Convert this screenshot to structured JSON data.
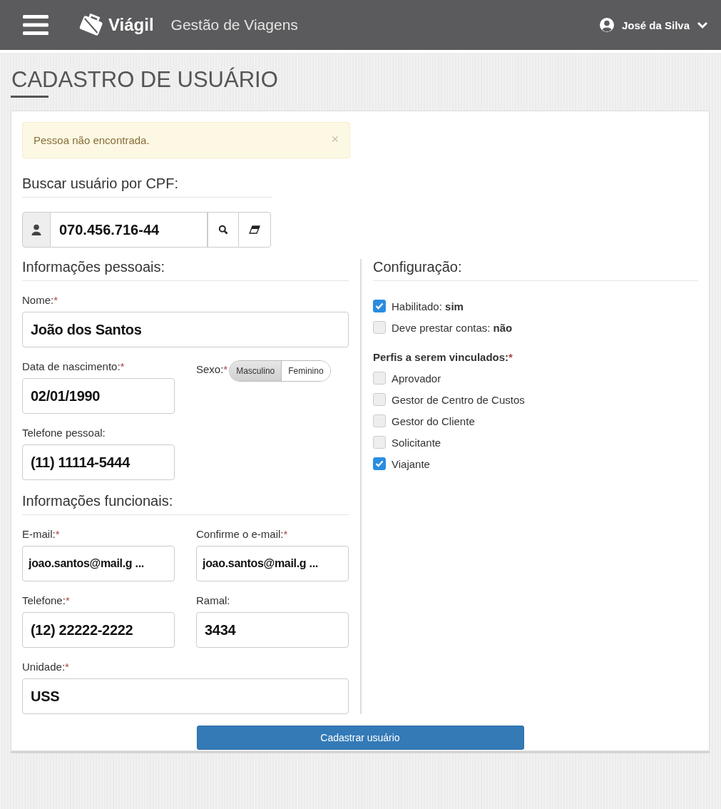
{
  "header": {
    "brand": "Viágil",
    "subtitle": "Gestão de Viagens",
    "user": "José da Silva"
  },
  "page_title": "CADASTRO DE USUÁRIO",
  "alert": {
    "message": "Pessoa não encontrada.",
    "close": "×"
  },
  "search": {
    "heading": "Buscar usuário por CPF:",
    "value": "070.456.716-44"
  },
  "personal": {
    "heading": "Informações pessoais:",
    "nome": {
      "label": "Nome:",
      "required_mark": "*",
      "value": "João dos Santos"
    },
    "nascimento": {
      "label": "Data de nascimento:",
      "required_mark": "*",
      "value": "02/01/1990"
    },
    "sexo": {
      "label": "Sexo:",
      "required_mark": "*",
      "options": [
        {
          "label": "Masculino",
          "selected": true
        },
        {
          "label": "Feminino",
          "selected": false
        }
      ]
    },
    "telefone": {
      "label": "Telefone pessoal:",
      "value": "(11) 11114-5444"
    }
  },
  "functional": {
    "heading": "Informações funcionais:",
    "fields": [
      {
        "label": "E-mail:",
        "required_mark": "*",
        "value": "joao.santos@mail.g ..."
      },
      {
        "label": "Confirme o e-mail:",
        "required_mark": "*",
        "value": "joao.santos@mail.g ..."
      },
      {
        "label": "Telefone:",
        "required_mark": "*",
        "value": "(12) 22222-2222"
      },
      {
        "label": "Ramal:",
        "value": "3434"
      },
      {
        "label": "Unidade:",
        "required_mark": "*",
        "value": "USS",
        "wide": true
      }
    ]
  },
  "config": {
    "heading": "Configuração:",
    "options": [
      {
        "label": "Habilitado: **sim**",
        "checked": true
      },
      {
        "label": "Deve prestar contas: **não**",
        "checked": false
      }
    ],
    "profiles_label": "Perfis a serem vinculados:",
    "profiles_required_mark": "*",
    "profiles": [
      {
        "label": "Aprovador",
        "checked": false
      },
      {
        "label": "Gestor de Centro de Custos",
        "checked": false
      },
      {
        "label": "Gestor do Cliente",
        "checked": false
      },
      {
        "label": "Solicitante",
        "checked": false
      },
      {
        "label": "Viajante",
        "checked": true
      }
    ]
  },
  "submit": "Cadastrar usuário"
}
